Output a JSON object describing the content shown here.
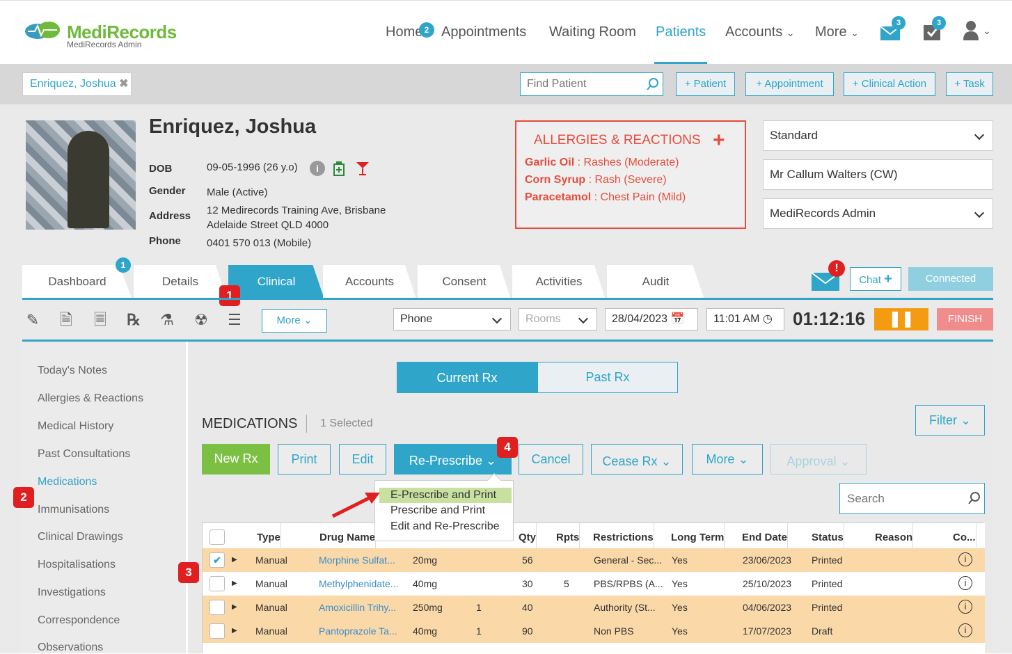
{
  "app": {
    "logo_main": "MediRecords",
    "logo_sub": "MediRecords Admin"
  },
  "nav": [
    {
      "label": "Home",
      "badge": "2"
    },
    {
      "label": "Appointments"
    },
    {
      "label": "Waiting Room"
    },
    {
      "label": "Patients",
      "active": true
    },
    {
      "label": "Accounts"
    },
    {
      "label": "More"
    }
  ],
  "nav_badges": {
    "mail": "3",
    "tasks": "3"
  },
  "search": {
    "tag": "Enriquez, Joshua",
    "placeholder": "Find Patient"
  },
  "actions": [
    "+ Patient",
    "+ Appointment",
    "+ Clinical Action",
    "+ Task"
  ],
  "patient": {
    "name": "Enriquez, Joshua",
    "dob_label": "DOB",
    "dob": "09-05-1996 (26 y.o)",
    "gender_label": "Gender",
    "gender": "Male (Active)",
    "address_label": "Address",
    "address1": "12 Medirecords Training Ave, Brisbane",
    "address2": "Adelaide Street QLD 4000",
    "phone_label": "Phone",
    "phone": "0401 570 013 (Mobile)"
  },
  "allergies": {
    "title": "ALLERGIES & REACTIONS",
    "items": [
      {
        "name": "Garlic Oil",
        "reaction": " : Rashes (Moderate)"
      },
      {
        "name": "Corn Syrup",
        "reaction": " : Rash (Severe)"
      },
      {
        "name": "Paracetamol",
        "reaction": " : Chest Pain (Mild)"
      }
    ]
  },
  "right_selects": {
    "s1": "Standard",
    "s2": "Mr Callum Walters (CW)",
    "s3": "MediRecords Admin"
  },
  "tabs": [
    "Dashboard",
    "Details",
    "Clinical",
    "Accounts",
    "Consent",
    "Activities",
    "Audit"
  ],
  "tab_badge": "1",
  "chat": {
    "label": "Chat",
    "status": "Connected"
  },
  "toolbar": {
    "more": "More",
    "mode": "Phone",
    "rooms": "Rooms",
    "date": "28/04/2023",
    "time": "11:01 AM",
    "timer": "01:12:16",
    "finish": "FINISH"
  },
  "sidebar": [
    "Today's Notes",
    "Allergies & Reactions",
    "Medical History",
    "Past Consultations",
    "Medications",
    "Immunisations",
    "Clinical Drawings",
    "Hospitalisations",
    "Investigations",
    "Correspondence",
    "Observations"
  ],
  "rx_toggle": {
    "current": "Current Rx",
    "past": "Past Rx"
  },
  "meds": {
    "title": "MEDICATIONS",
    "selected": "1 Selected",
    "filter": "Filter",
    "search_placeholder": "Search"
  },
  "buttons": {
    "new_rx": "New Rx",
    "print": "Print",
    "edit": "Edit",
    "represcribe": "Re-Prescribe",
    "cancel": "Cancel",
    "cease": "Cease Rx",
    "more": "More",
    "approval": "Approval"
  },
  "menu": [
    "E-Prescribe and Print",
    "Prescribe and Print",
    "Edit and Re-Prescribe"
  ],
  "steps": [
    "1",
    "2",
    "3",
    "4"
  ],
  "columns": [
    "Type",
    "Drug Name",
    "Qty",
    "Rpts",
    "Restrictions",
    "Long Term",
    "End Date",
    "Status",
    "Reason",
    "Co..."
  ],
  "rows": [
    {
      "type": "Manual",
      "drug": "Morphine Sulfat...",
      "dose": "20mg",
      "x": "",
      "qty": "56",
      "rpts": "",
      "restr": "General - Sec...",
      "lt": "Yes",
      "end": "23/06/2023",
      "status": "Printed"
    },
    {
      "type": "Manual",
      "drug": "Methylphenidate...",
      "dose": "40mg",
      "x": "",
      "qty": "30",
      "rpts": "5",
      "restr": "PBS/RPBS (A...",
      "lt": "Yes",
      "end": "25/10/2023",
      "status": "Printed"
    },
    {
      "type": "Manual",
      "drug": "Amoxicillin Trihy...",
      "dose": "250mg",
      "x": "1",
      "qty": "40",
      "rpts": "",
      "restr": "Authority (St...",
      "lt": "Yes",
      "end": "04/06/2023",
      "status": "Printed"
    },
    {
      "type": "Manual",
      "drug": "Pantoprazole Ta...",
      "dose": "40mg",
      "x": "1",
      "qty": "90",
      "rpts": "",
      "restr": "Non PBS",
      "lt": "Yes",
      "end": "17/07/2023",
      "status": "Draft"
    }
  ]
}
